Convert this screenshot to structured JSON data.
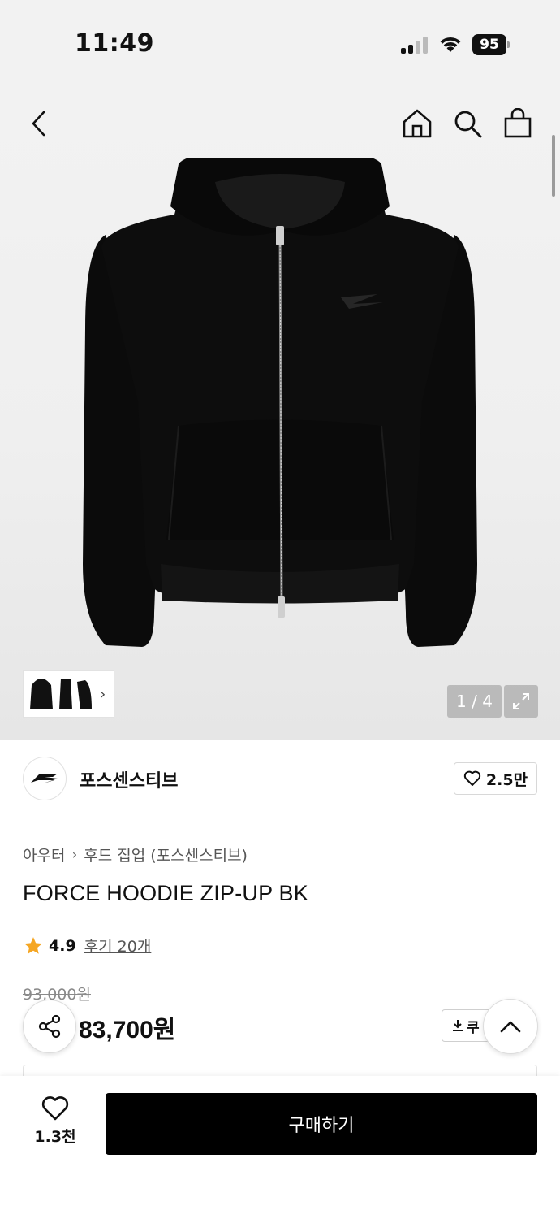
{
  "status_bar": {
    "time": "11:49",
    "battery": "95"
  },
  "nav": {
    "icons": [
      "back-icon",
      "home-icon",
      "search-icon",
      "cart-icon"
    ]
  },
  "gallery": {
    "counter": "1 / 4"
  },
  "brand": {
    "name": "포스센스티브",
    "likes": "2.5만"
  },
  "breadcrumb": {
    "category": "아우터",
    "subcategory": "후드 집업 (포스센스티브)"
  },
  "product": {
    "title": "FORCE HOODIE ZIP-UP BK",
    "rating": "4.9",
    "reviews": "후기 20개",
    "original_price": "93,000원",
    "sale_price": "83,700원",
    "coupon_label": "쿠"
  },
  "bottom": {
    "wish_count": "1.3천",
    "buy_label": "구매하기"
  },
  "colors": {
    "accent_star": "#f5a623",
    "buy_button": "#000000"
  }
}
